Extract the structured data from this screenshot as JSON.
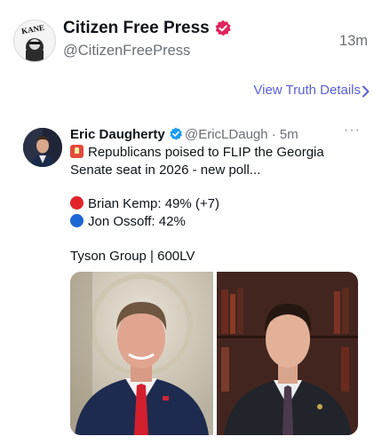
{
  "post": {
    "author_name": "Citizen Free Press",
    "author_handle": "@CitizenFreePress",
    "time": "13m",
    "view_details": "View Truth Details",
    "avatar_text": "KANE"
  },
  "embedded": {
    "author_name": "Eric Daugherty",
    "meta": "@EricLDaugh · 5m",
    "more": "···",
    "line1": "Republicans poised to FLIP the Georgia",
    "line2": "Senate seat in 2026 - new poll...",
    "kemp": "Brian Kemp: 49% (+7)",
    "ossoff": "Jon Ossoff: 42%",
    "source": "Tyson Group | 600LV"
  },
  "colors": {
    "link": "#5b5fd8",
    "verified_red": "#e0245e",
    "verified_blue": "#1d9bf0",
    "red_dot": "#e0242a",
    "blue_dot": "#1e66d6"
  },
  "icons": {
    "verified_author": "verified-badge-red-icon",
    "verified_embed": "verified-badge-blue-icon",
    "chevron": "chevron-right-icon",
    "siren": "rotating-light-emoji",
    "red_circle": "red-circle-emoji",
    "blue_circle": "blue-circle-emoji"
  }
}
